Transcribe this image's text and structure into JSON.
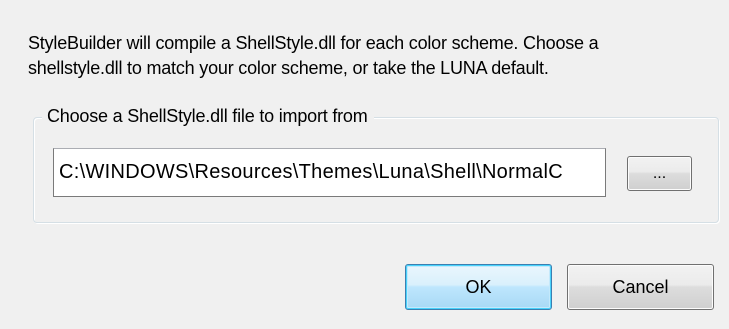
{
  "description": {
    "line1": "StyleBuilder will compile a ShellStyle.dll for each color scheme.  Choose a",
    "line2": "shellstyle.dll to match your color scheme,  or take the LUNA default."
  },
  "group": {
    "legend": "Choose a ShellStyle.dll file to import from",
    "path_value": "C:\\WINDOWS\\Resources\\Themes\\Luna\\Shell\\NormalC",
    "browse_label": "..."
  },
  "buttons": {
    "ok_label": "OK",
    "cancel_label": "Cancel"
  }
}
